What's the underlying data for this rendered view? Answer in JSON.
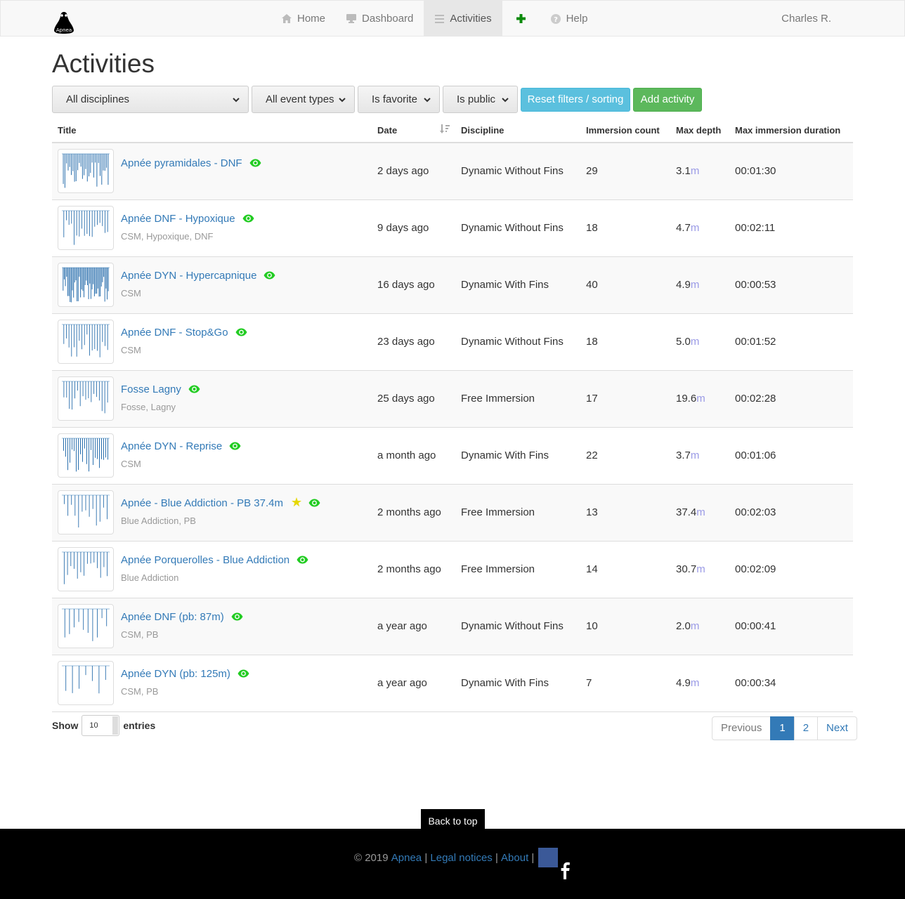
{
  "navbar": {
    "brand": "Apnea",
    "items": [
      {
        "label": "Home",
        "icon": "home-icon"
      },
      {
        "label": "Dashboard",
        "icon": "dashboard-icon"
      },
      {
        "label": "Activities",
        "icon": "list-icon",
        "active": true
      },
      {
        "label": "",
        "icon": "plus-icon"
      },
      {
        "label": "Help",
        "icon": "help-icon"
      }
    ],
    "user": "Charles R."
  },
  "page": {
    "title": "Activities"
  },
  "filters": {
    "discipline": "All disciplines",
    "event_type": "All event types",
    "favorite": "Is favorite",
    "public": "Is public",
    "reset_label": "Reset filters / sorting",
    "add_label": "Add activity"
  },
  "table": {
    "headers": {
      "title": "Title",
      "date": "Date",
      "discipline": "Discipline",
      "immersion_count": "Immersion count",
      "max_depth": "Max depth",
      "max_duration": "Max immersion duration"
    },
    "depth_unit": "m",
    "rows": [
      {
        "title": "Apnée pyramidales - DNF",
        "tags": "",
        "favorite": false,
        "date": "2 days ago",
        "discipline": "Dynamic Without Fins",
        "count": "29",
        "depth": "3.1",
        "duration": "00:01:30"
      },
      {
        "title": "Apnée DNF - Hypoxique",
        "tags": "CSM, Hypoxique, DNF",
        "favorite": false,
        "date": "9 days ago",
        "discipline": "Dynamic Without Fins",
        "count": "18",
        "depth": "4.7",
        "duration": "00:02:11"
      },
      {
        "title": "Apnée DYN - Hypercapnique",
        "tags": "CSM",
        "favorite": false,
        "date": "16 days ago",
        "discipline": "Dynamic With Fins",
        "count": "40",
        "depth": "4.9",
        "duration": "00:00:53"
      },
      {
        "title": "Apnée DNF - Stop&Go",
        "tags": "CSM",
        "favorite": false,
        "date": "23 days ago",
        "discipline": "Dynamic Without Fins",
        "count": "18",
        "depth": "5.0",
        "duration": "00:01:52"
      },
      {
        "title": "Fosse Lagny",
        "tags": "Fosse, Lagny",
        "favorite": false,
        "date": "25 days ago",
        "discipline": "Free Immersion",
        "count": "17",
        "depth": "19.6",
        "duration": "00:02:28"
      },
      {
        "title": "Apnée DYN - Reprise",
        "tags": "CSM",
        "favorite": false,
        "date": "a month ago",
        "discipline": "Dynamic With Fins",
        "count": "22",
        "depth": "3.7",
        "duration": "00:01:06"
      },
      {
        "title": "Apnée - Blue Addiction - PB 37.4m",
        "tags": "Blue Addiction, PB",
        "favorite": true,
        "date": "2 months ago",
        "discipline": "Free Immersion",
        "count": "13",
        "depth": "37.4",
        "duration": "00:02:03"
      },
      {
        "title": "Apnée Porquerolles - Blue Addiction",
        "tags": "Blue Addiction",
        "favorite": false,
        "date": "2 months ago",
        "discipline": "Free Immersion",
        "count": "14",
        "depth": "30.7",
        "duration": "00:02:09"
      },
      {
        "title": "Apnée DNF (pb: 87m)",
        "tags": "CSM, PB",
        "favorite": false,
        "date": "a year ago",
        "discipline": "Dynamic Without Fins",
        "count": "10",
        "depth": "2.0",
        "duration": "00:00:41"
      },
      {
        "title": "Apnée DYN (pb: 125m)",
        "tags": "CSM, PB",
        "favorite": false,
        "date": "a year ago",
        "discipline": "Dynamic With Fins",
        "count": "7",
        "depth": "4.9",
        "duration": "00:00:34"
      }
    ]
  },
  "length": {
    "show": "Show",
    "value": "10",
    "entries": "entries"
  },
  "pagination": {
    "previous": "Previous",
    "pages": [
      "1",
      "2"
    ],
    "next": "Next"
  },
  "back_to_top": "Back to top",
  "footer": {
    "copyright": "© 2019",
    "brand": "Apnea",
    "legal": "Legal notices",
    "about": "About",
    "sep": "|"
  },
  "colors": {
    "link": "#337ab7",
    "info": "#5bc0de",
    "success": "#5cb85c",
    "eye": "#22cc22",
    "star": "#e6d800",
    "unit": "#9a9ae6"
  }
}
